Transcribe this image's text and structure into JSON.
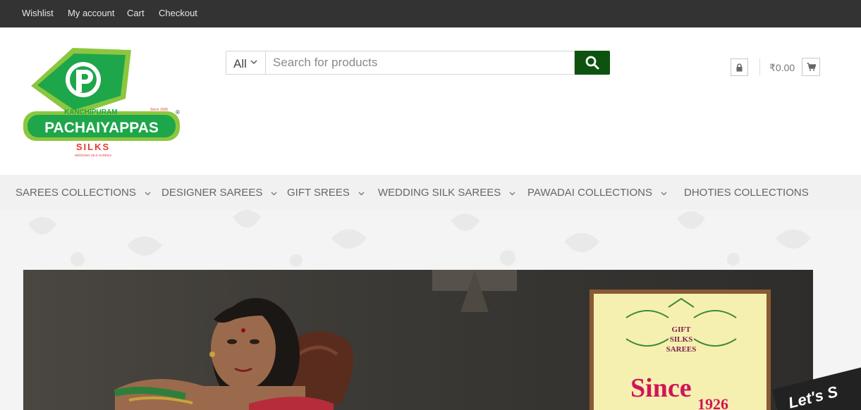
{
  "topbar": {
    "links": [
      "Wishlist",
      "My account",
      "Cart",
      "Checkout"
    ]
  },
  "logo": {
    "brand_top": "KANCHIPURAM",
    "brand_main": "PACHAIYAPPAS",
    "brand_sub": "SILKS",
    "tagline": "WEDDING SILK SAREES",
    "since": "Since 1926",
    "registered": "®"
  },
  "search": {
    "category": "All",
    "placeholder": "Search for products"
  },
  "header": {
    "cart_total": "₹0.00"
  },
  "nav": {
    "items": [
      "SAREES COLLECTIONS",
      "DESIGNER SAREES",
      "GIFT SREES",
      "WEDDING SILK SAREES",
      "PAWADAI COLLECTIONS",
      "DHOTIES COLLECTIONS"
    ]
  },
  "banner": {
    "badge_line1": "GIFT",
    "badge_line2": "SILKS",
    "badge_line3": "SAREES",
    "since_word": "Since",
    "since_year": "1926",
    "corner_text": "Let's S"
  },
  "colors": {
    "topbar": "#333333",
    "search_button": "#0e520f",
    "brand_green": "#1ea64a",
    "brand_lime": "#8cc63f",
    "nav_bg": "#f1f1f1"
  }
}
